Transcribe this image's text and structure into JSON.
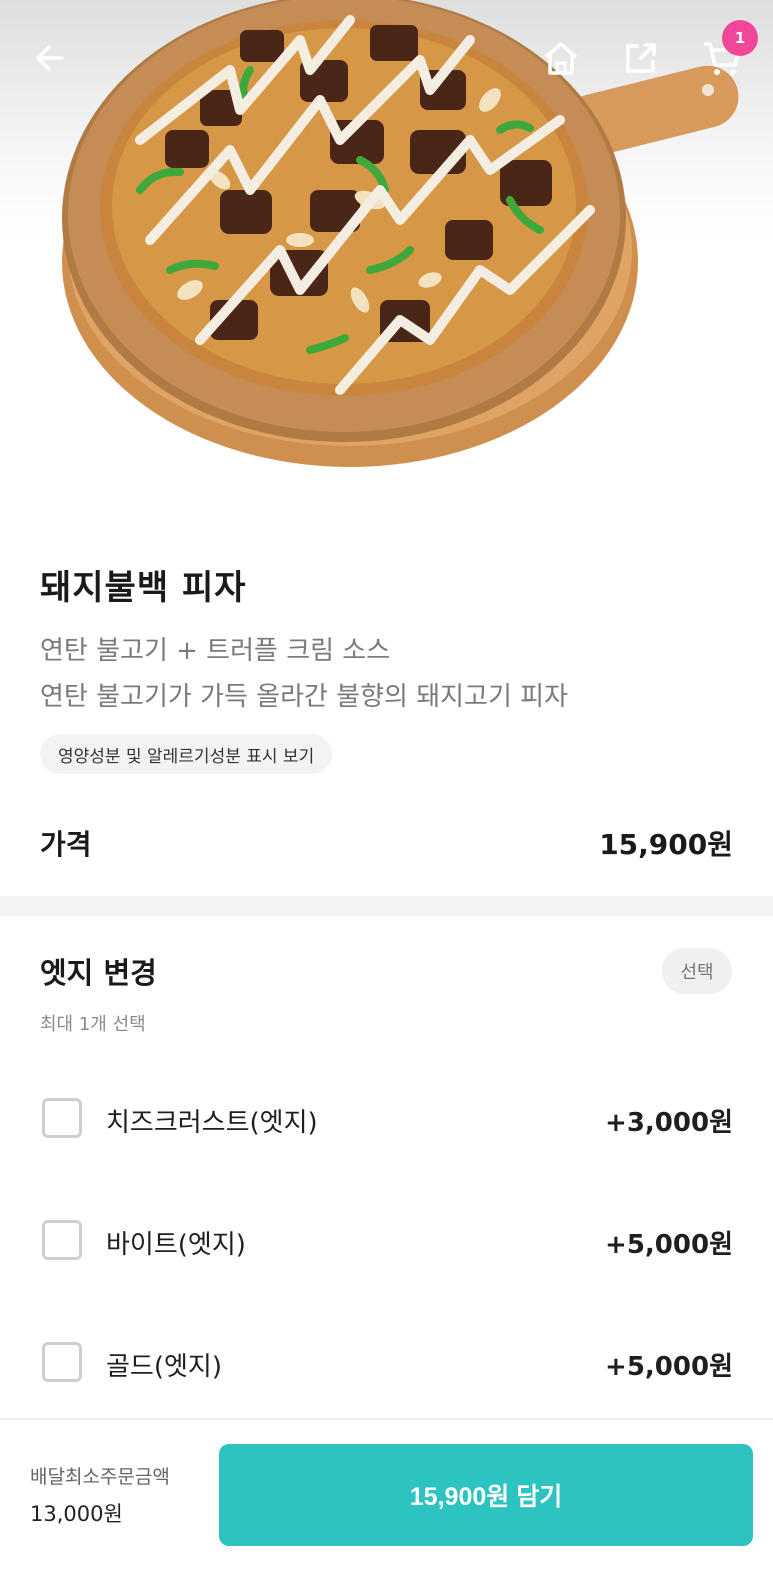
{
  "header": {
    "back_icon": "arrow-left-icon",
    "home_icon": "home-icon",
    "share_icon": "share-icon",
    "cart_icon": "cart-icon",
    "cart_count": "1",
    "badge_color": "#f0479b"
  },
  "product": {
    "name": "돼지불백 피자",
    "subtitle": "연탄 불고기 + 트러플 크림 소스",
    "description": "연탄 불고기가 가득 올라간 불향의 돼지고기 피자",
    "nutrition_link": "영양성분 및 알레르기성분 표시 보기",
    "price_label": "가격",
    "price_value": "15,900원"
  },
  "option_group": {
    "title": "엣지 변경",
    "subtitle": "최대 1개 선택",
    "badge": "선택",
    "options": [
      {
        "label": "치즈크러스트(엣지)",
        "price": "+3,000원",
        "checked": false
      },
      {
        "label": "바이트(엣지)",
        "price": "+5,000원",
        "checked": false
      },
      {
        "label": "골드(엣지)",
        "price": "+5,000원",
        "checked": false
      }
    ]
  },
  "footer": {
    "min_order_label": "배달최소주문금액",
    "min_order_value": "13,000원",
    "add_button": "15,900원 담기",
    "accent_color": "#2cc3c0"
  }
}
